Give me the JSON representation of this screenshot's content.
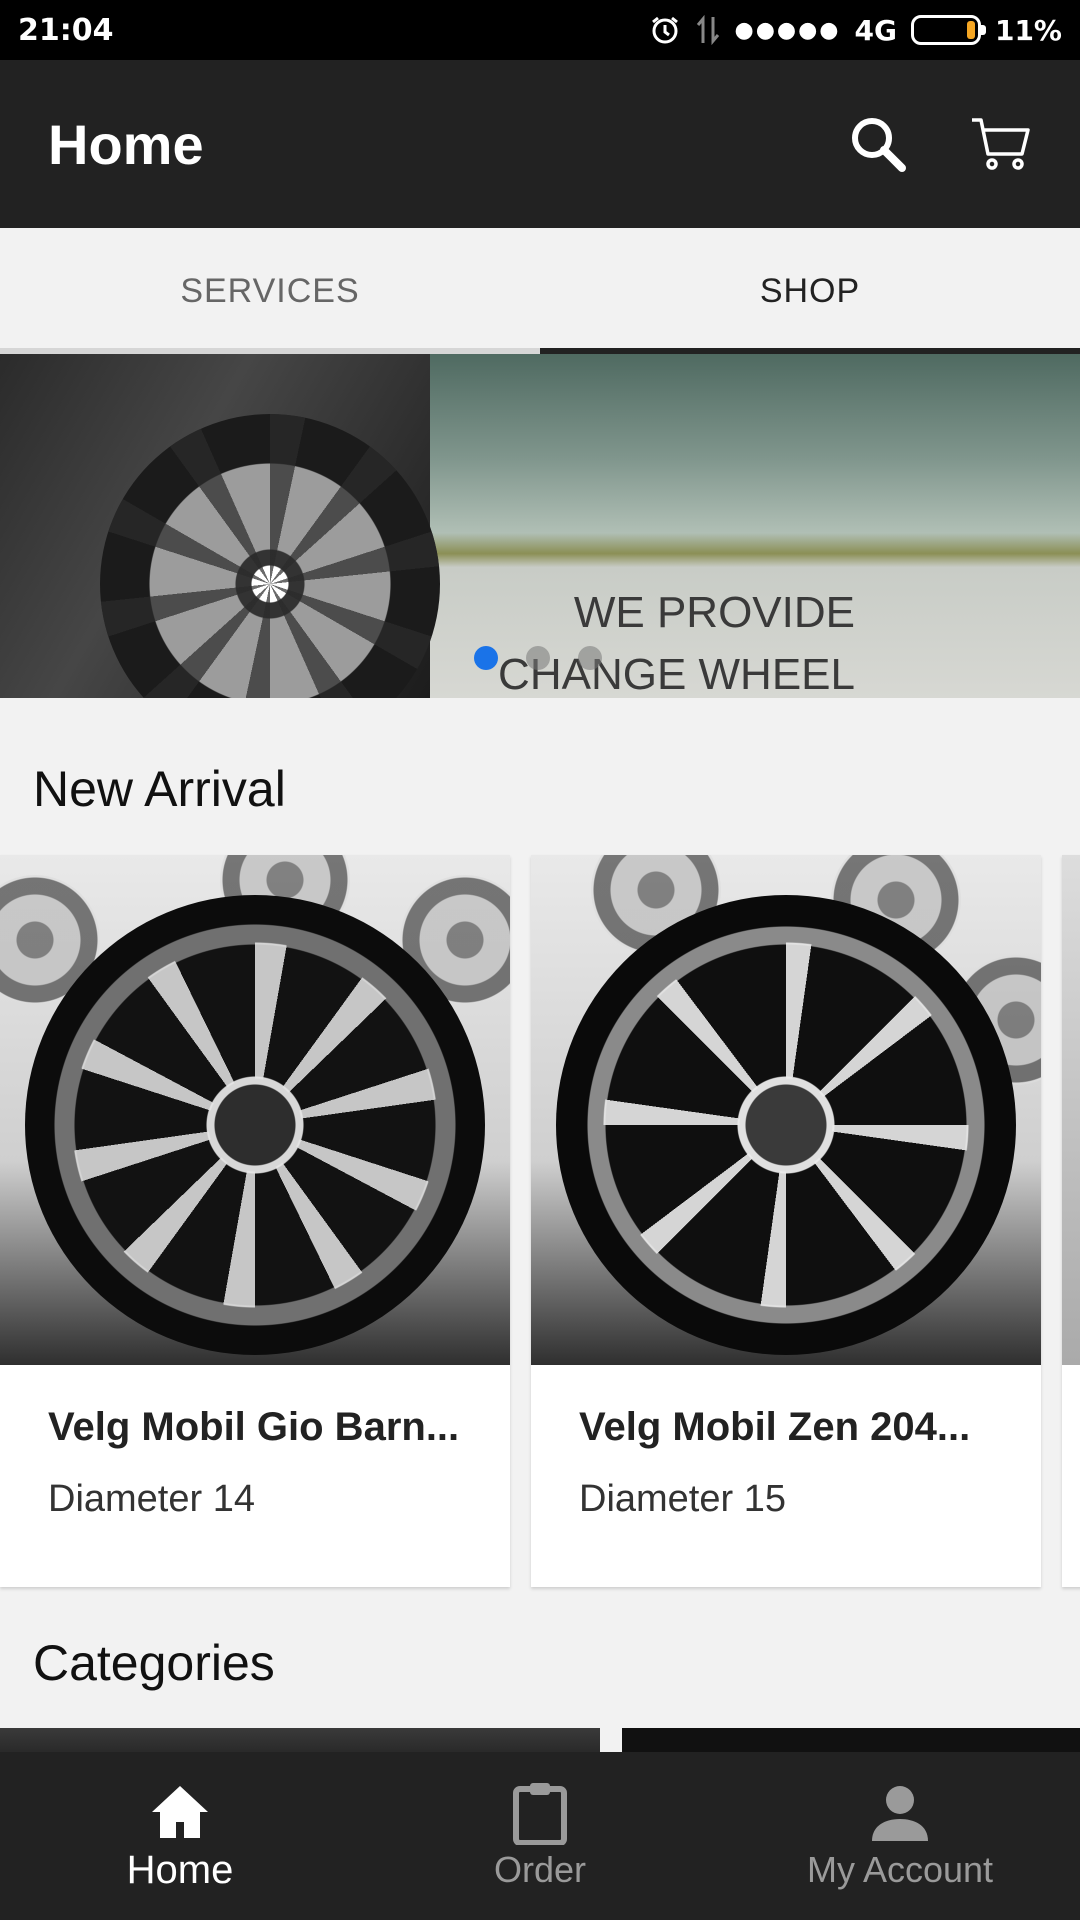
{
  "status_bar": {
    "time": "21:04",
    "signal_dots": "●●●●●",
    "network": "4G",
    "battery": "11%",
    "battery_level": 0.11,
    "icons": [
      "alarm-icon",
      "data-transfer-icon",
      "signal-icon",
      "battery-icon"
    ]
  },
  "app_bar": {
    "title": "Home",
    "actions": [
      "search-icon",
      "cart-icon"
    ]
  },
  "tabs": {
    "items": [
      {
        "label": "SERVICES",
        "active": false
      },
      {
        "label": "SHOP",
        "active": true
      }
    ]
  },
  "banner": {
    "line1": "WE PROVIDE",
    "line2": "CHANGE WHEEL",
    "slide_count": 3,
    "active_slide": 1
  },
  "new_arrival": {
    "title": "New Arrival",
    "products": [
      {
        "name": "Velg Mobil Gio Barn...",
        "subtitle": "Diameter 14"
      },
      {
        "name": "Velg Mobil Zen 204...",
        "subtitle": "Diameter 15"
      }
    ]
  },
  "categories": {
    "title": "Categories"
  },
  "bottom_nav": {
    "items": [
      {
        "label": "Home",
        "icon": "home-icon",
        "active": true
      },
      {
        "label": "Order",
        "icon": "clipboard-icon",
        "active": false
      },
      {
        "label": "My Account",
        "icon": "person-icon",
        "active": false
      }
    ]
  },
  "colors": {
    "app_bar": "#222222",
    "tab_indicator": "#222222",
    "active_dot": "#1a73e8",
    "battery_fill": "#f5a623"
  }
}
